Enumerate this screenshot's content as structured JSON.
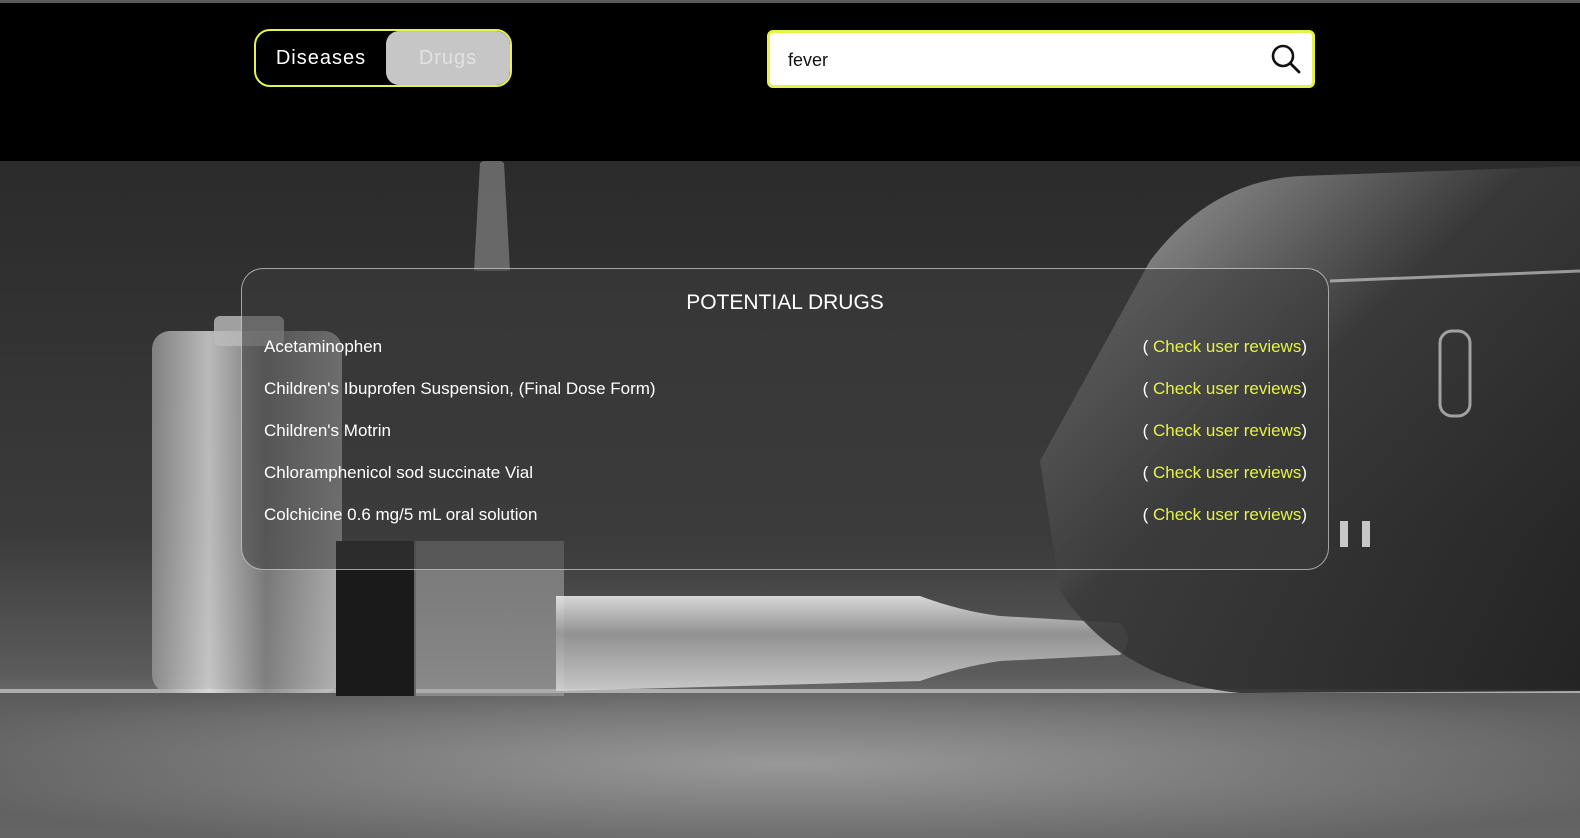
{
  "header": {
    "toggle": {
      "diseases_label": "Diseases",
      "drugs_label": "Drugs",
      "selected": "Drugs"
    },
    "search": {
      "value": "fever",
      "icon": "search-icon"
    }
  },
  "results": {
    "title": "POTENTIAL DRUGS",
    "review_open": "( ",
    "review_close": ")",
    "items": [
      {
        "name": "Acetaminophen",
        "link": "Check user reviews"
      },
      {
        "name": "Children's Ibuprofen Suspension, (Final Dose Form)",
        "link": "Check user reviews"
      },
      {
        "name": "Children's Motrin",
        "link": "Check user reviews"
      },
      {
        "name": "Chloramphenicol sod succinate Vial",
        "link": "Check user reviews"
      },
      {
        "name": "Colchicine 0.6 mg/5 mL oral solution",
        "link": "Check user reviews"
      }
    ]
  },
  "colors": {
    "accent": "#e4f24a",
    "header_bg": "#000000",
    "toggle_selected_bg": "#c6c6c6"
  }
}
